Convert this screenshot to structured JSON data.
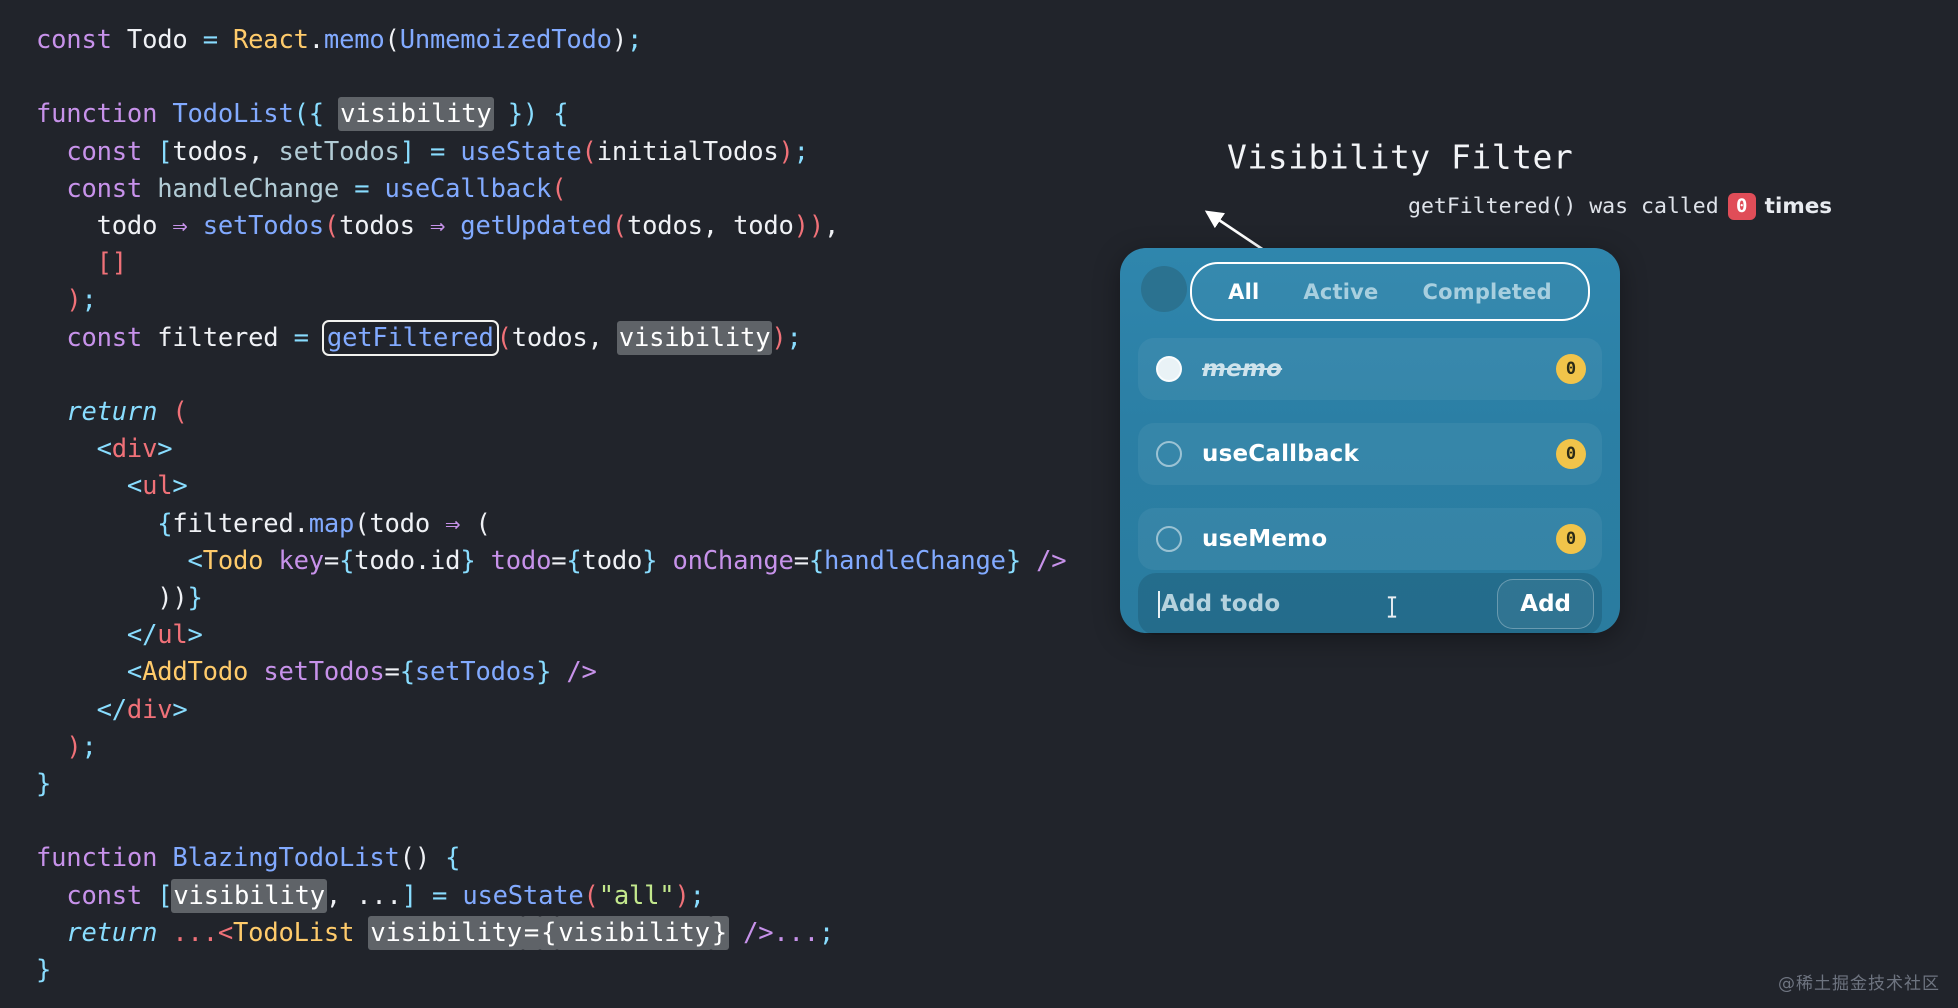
{
  "code": {
    "lines": [
      [
        {
          "t": "const",
          "c": "t-key"
        },
        {
          "t": " ",
          "c": "t-plain"
        },
        {
          "t": "Todo",
          "c": "t-plain"
        },
        {
          "t": " ",
          "c": "t-plain"
        },
        {
          "t": "=",
          "c": "t-op"
        },
        {
          "t": " ",
          "c": "t-plain"
        },
        {
          "t": "React",
          "c": "t-comp"
        },
        {
          "t": ".",
          "c": "t-plain"
        },
        {
          "t": "memo",
          "c": "t-fn"
        },
        {
          "t": "(",
          "c": "t-plain"
        },
        {
          "t": "UnmemoizedTodo",
          "c": "t-fn"
        },
        {
          "t": ")",
          "c": "t-plain"
        },
        {
          "t": ";",
          "c": "t-punct"
        }
      ],
      [],
      [
        {
          "t": "function",
          "c": "t-key"
        },
        {
          "t": " ",
          "c": "t-plain"
        },
        {
          "t": "TodoList",
          "c": "t-fn"
        },
        {
          "t": "(",
          "c": "t-punct"
        },
        {
          "t": "{ ",
          "c": "t-punct"
        },
        {
          "t": "visibility",
          "c": "t-plain",
          "hl": "grey"
        },
        {
          "t": " }",
          "c": "t-punct"
        },
        {
          "t": ")",
          "c": "t-punct"
        },
        {
          "t": " ",
          "c": "t-plain"
        },
        {
          "t": "{",
          "c": "t-punct"
        }
      ],
      [
        {
          "t": "  ",
          "c": "t-plain"
        },
        {
          "t": "const",
          "c": "t-key"
        },
        {
          "t": " ",
          "c": "t-plain"
        },
        {
          "t": "[",
          "c": "t-bracket"
        },
        {
          "t": "todos",
          "c": "t-plain"
        },
        {
          "t": ", ",
          "c": "t-plain"
        },
        {
          "t": "setTodos",
          "c": "t-var"
        },
        {
          "t": "]",
          "c": "t-bracket"
        },
        {
          "t": " ",
          "c": "t-plain"
        },
        {
          "t": "=",
          "c": "t-op"
        },
        {
          "t": " ",
          "c": "t-plain"
        },
        {
          "t": "useState",
          "c": "t-fn"
        },
        {
          "t": "(",
          "c": "t-paren"
        },
        {
          "t": "initialTodos",
          "c": "t-plain"
        },
        {
          "t": ")",
          "c": "t-paren"
        },
        {
          "t": ";",
          "c": "t-punct"
        }
      ],
      [
        {
          "t": "  ",
          "c": "t-plain"
        },
        {
          "t": "const",
          "c": "t-key"
        },
        {
          "t": " ",
          "c": "t-plain"
        },
        {
          "t": "handleChange",
          "c": "t-var"
        },
        {
          "t": " ",
          "c": "t-plain"
        },
        {
          "t": "=",
          "c": "t-op"
        },
        {
          "t": " ",
          "c": "t-plain"
        },
        {
          "t": "useCallback",
          "c": "t-fn"
        },
        {
          "t": "(",
          "c": "t-paren"
        }
      ],
      [
        {
          "t": "    ",
          "c": "t-plain"
        },
        {
          "t": "todo",
          "c": "t-plain"
        },
        {
          "t": " ",
          "c": "t-plain"
        },
        {
          "t": "⇒",
          "c": "t-attr"
        },
        {
          "t": " ",
          "c": "t-plain"
        },
        {
          "t": "setTodos",
          "c": "t-fn"
        },
        {
          "t": "(",
          "c": "t-paren"
        },
        {
          "t": "todos",
          "c": "t-plain"
        },
        {
          "t": " ",
          "c": "t-plain"
        },
        {
          "t": "⇒",
          "c": "t-attr"
        },
        {
          "t": " ",
          "c": "t-plain"
        },
        {
          "t": "getUpdated",
          "c": "t-fn"
        },
        {
          "t": "(",
          "c": "t-paren"
        },
        {
          "t": "todos",
          "c": "t-plain"
        },
        {
          "t": ", ",
          "c": "t-plain"
        },
        {
          "t": "todo",
          "c": "t-plain"
        },
        {
          "t": ")",
          "c": "t-paren"
        },
        {
          "t": ")",
          "c": "t-paren"
        },
        {
          "t": ",",
          "c": "t-plain"
        }
      ],
      [
        {
          "t": "    ",
          "c": "t-plain"
        },
        {
          "t": "[]",
          "c": "t-paren"
        }
      ],
      [
        {
          "t": "  ",
          "c": "t-plain"
        },
        {
          "t": ")",
          "c": "t-paren"
        },
        {
          "t": ";",
          "c": "t-punct"
        }
      ],
      [
        {
          "t": "  ",
          "c": "t-plain"
        },
        {
          "t": "const",
          "c": "t-key"
        },
        {
          "t": " ",
          "c": "t-plain"
        },
        {
          "t": "filtered",
          "c": "t-plain"
        },
        {
          "t": " ",
          "c": "t-plain"
        },
        {
          "t": "=",
          "c": "t-op"
        },
        {
          "t": " ",
          "c": "t-plain"
        },
        {
          "t": "getFiltered",
          "c": "t-fn",
          "hl": "box"
        },
        {
          "t": "(",
          "c": "t-paren"
        },
        {
          "t": "todos",
          "c": "t-plain"
        },
        {
          "t": ", ",
          "c": "t-plain"
        },
        {
          "t": "visibility",
          "c": "t-plain",
          "hl": "grey"
        },
        {
          "t": ")",
          "c": "t-paren"
        },
        {
          "t": ";",
          "c": "t-punct"
        }
      ],
      [],
      [
        {
          "t": "  ",
          "c": "t-plain"
        },
        {
          "t": "return",
          "c": "t-kw-it"
        },
        {
          "t": " ",
          "c": "t-plain"
        },
        {
          "t": "(",
          "c": "t-paren"
        }
      ],
      [
        {
          "t": "    ",
          "c": "t-plain"
        },
        {
          "t": "<",
          "c": "t-punct"
        },
        {
          "t": "div",
          "c": "t-tag"
        },
        {
          "t": ">",
          "c": "t-punct"
        }
      ],
      [
        {
          "t": "      ",
          "c": "t-plain"
        },
        {
          "t": "<",
          "c": "t-punct"
        },
        {
          "t": "ul",
          "c": "t-tag"
        },
        {
          "t": ">",
          "c": "t-punct"
        }
      ],
      [
        {
          "t": "        ",
          "c": "t-plain"
        },
        {
          "t": "{",
          "c": "t-brace"
        },
        {
          "t": "filtered",
          "c": "t-plain"
        },
        {
          "t": ".",
          "c": "t-plain"
        },
        {
          "t": "map",
          "c": "t-fn"
        },
        {
          "t": "(",
          "c": "t-plain"
        },
        {
          "t": "todo",
          "c": "t-plain"
        },
        {
          "t": " ",
          "c": "t-plain"
        },
        {
          "t": "⇒",
          "c": "t-attr"
        },
        {
          "t": " ",
          "c": "t-plain"
        },
        {
          "t": "(",
          "c": "t-plain"
        }
      ],
      [
        {
          "t": "          ",
          "c": "t-plain"
        },
        {
          "t": "<",
          "c": "t-punct"
        },
        {
          "t": "Todo",
          "c": "t-comp"
        },
        {
          "t": " ",
          "c": "t-plain"
        },
        {
          "t": "key",
          "c": "t-attr"
        },
        {
          "t": "=",
          "c": "t-plain"
        },
        {
          "t": "{",
          "c": "t-brace"
        },
        {
          "t": "todo.id",
          "c": "t-plain"
        },
        {
          "t": "}",
          "c": "t-brace"
        },
        {
          "t": " ",
          "c": "t-plain"
        },
        {
          "t": "todo",
          "c": "t-attr"
        },
        {
          "t": "=",
          "c": "t-plain"
        },
        {
          "t": "{",
          "c": "t-brace"
        },
        {
          "t": "todo",
          "c": "t-plain"
        },
        {
          "t": "}",
          "c": "t-brace"
        },
        {
          "t": " ",
          "c": "t-plain"
        },
        {
          "t": "onChange",
          "c": "t-attr"
        },
        {
          "t": "=",
          "c": "t-plain"
        },
        {
          "t": "{",
          "c": "t-brace"
        },
        {
          "t": "handleChange",
          "c": "t-fn"
        },
        {
          "t": "}",
          "c": "t-brace"
        },
        {
          "t": " ",
          "c": "t-plain"
        },
        {
          "t": "/>",
          "c": "t-attr"
        }
      ],
      [
        {
          "t": "        ",
          "c": "t-plain"
        },
        {
          "t": "))",
          "c": "t-plain"
        },
        {
          "t": "}",
          "c": "t-brace"
        }
      ],
      [
        {
          "t": "      ",
          "c": "t-plain"
        },
        {
          "t": "</",
          "c": "t-punct"
        },
        {
          "t": "ul",
          "c": "t-tag"
        },
        {
          "t": ">",
          "c": "t-punct"
        }
      ],
      [
        {
          "t": "      ",
          "c": "t-plain"
        },
        {
          "t": "<",
          "c": "t-punct"
        },
        {
          "t": "AddTodo",
          "c": "t-comp"
        },
        {
          "t": " ",
          "c": "t-plain"
        },
        {
          "t": "setTodos",
          "c": "t-attr"
        },
        {
          "t": "=",
          "c": "t-plain"
        },
        {
          "t": "{",
          "c": "t-brace"
        },
        {
          "t": "setTodos",
          "c": "t-fn"
        },
        {
          "t": "}",
          "c": "t-brace"
        },
        {
          "t": " ",
          "c": "t-plain"
        },
        {
          "t": "/>",
          "c": "t-attr"
        }
      ],
      [
        {
          "t": "    ",
          "c": "t-plain"
        },
        {
          "t": "</",
          "c": "t-punct"
        },
        {
          "t": "div",
          "c": "t-tag"
        },
        {
          "t": ">",
          "c": "t-punct"
        }
      ],
      [
        {
          "t": "  ",
          "c": "t-plain"
        },
        {
          "t": ")",
          "c": "t-paren"
        },
        {
          "t": ";",
          "c": "t-punct"
        }
      ],
      [
        {
          "t": "}",
          "c": "t-punct"
        }
      ],
      [],
      [
        {
          "t": "function",
          "c": "t-key"
        },
        {
          "t": " ",
          "c": "t-plain"
        },
        {
          "t": "BlazingTodoList",
          "c": "t-fn"
        },
        {
          "t": "()",
          "c": "t-plain"
        },
        {
          "t": " ",
          "c": "t-plain"
        },
        {
          "t": "{",
          "c": "t-punct"
        }
      ],
      [
        {
          "t": "  ",
          "c": "t-plain"
        },
        {
          "t": "const",
          "c": "t-key"
        },
        {
          "t": " ",
          "c": "t-plain"
        },
        {
          "t": "[",
          "c": "t-bracket"
        },
        {
          "t": "visibility",
          "c": "t-plain",
          "hl": "grey"
        },
        {
          "t": ", ",
          "c": "t-plain"
        },
        {
          "t": "...",
          "c": "t-plain"
        },
        {
          "t": "]",
          "c": "t-bracket"
        },
        {
          "t": " ",
          "c": "t-plain"
        },
        {
          "t": "=",
          "c": "t-op"
        },
        {
          "t": " ",
          "c": "t-plain"
        },
        {
          "t": "useState",
          "c": "t-fn"
        },
        {
          "t": "(",
          "c": "t-paren"
        },
        {
          "t": "\"all\"",
          "c": "t-str"
        },
        {
          "t": ")",
          "c": "t-paren"
        },
        {
          "t": ";",
          "c": "t-punct"
        }
      ],
      [
        {
          "t": "  ",
          "c": "t-plain"
        },
        {
          "t": "return",
          "c": "t-kw-it"
        },
        {
          "t": " ",
          "c": "t-plain"
        },
        {
          "t": "...",
          "c": "t-tag"
        },
        {
          "t": "<",
          "c": "t-tag"
        },
        {
          "t": "TodoList",
          "c": "t-comp"
        },
        {
          "t": " ",
          "c": "t-plain"
        },
        {
          "t": "visibility",
          "c": "t-attr",
          "hl": "grey"
        },
        {
          "t": "=",
          "c": "t-plain",
          "hl": "grey"
        },
        {
          "t": "{",
          "c": "t-brace",
          "hl": "grey"
        },
        {
          "t": "visibility",
          "c": "t-plain",
          "hl": "grey"
        },
        {
          "t": "}",
          "c": "t-brace",
          "hl": "grey"
        },
        {
          "t": " ",
          "c": "t-plain"
        },
        {
          "t": "/>",
          "c": "t-attr"
        },
        {
          "t": "...",
          "c": "t-attr"
        },
        {
          "t": ";",
          "c": "t-punct"
        }
      ],
      [
        {
          "t": "}",
          "c": "t-punct"
        }
      ]
    ]
  },
  "demo": {
    "title": "Visibility Filter",
    "annotation": {
      "prefix": "getFiltered() was called",
      "count": "0",
      "suffix": "times"
    },
    "tabs": [
      {
        "label": "All",
        "active": true
      },
      {
        "label": "Active",
        "active": false
      },
      {
        "label": "Completed",
        "active": false
      }
    ],
    "todos": [
      {
        "label": "memo",
        "done": true,
        "count": "0"
      },
      {
        "label": "useCallback",
        "done": false,
        "count": "0"
      },
      {
        "label": "useMemo",
        "done": false,
        "count": "0"
      }
    ],
    "add": {
      "placeholder": "Add todo",
      "value": "",
      "button_label": "Add"
    }
  },
  "watermark": "@稀土掘金技术社区",
  "colors": {
    "background": "#21242b",
    "card": "#2b7fa5",
    "badge_red": "#e04d58",
    "badge_yellow": "#f1c44a"
  }
}
